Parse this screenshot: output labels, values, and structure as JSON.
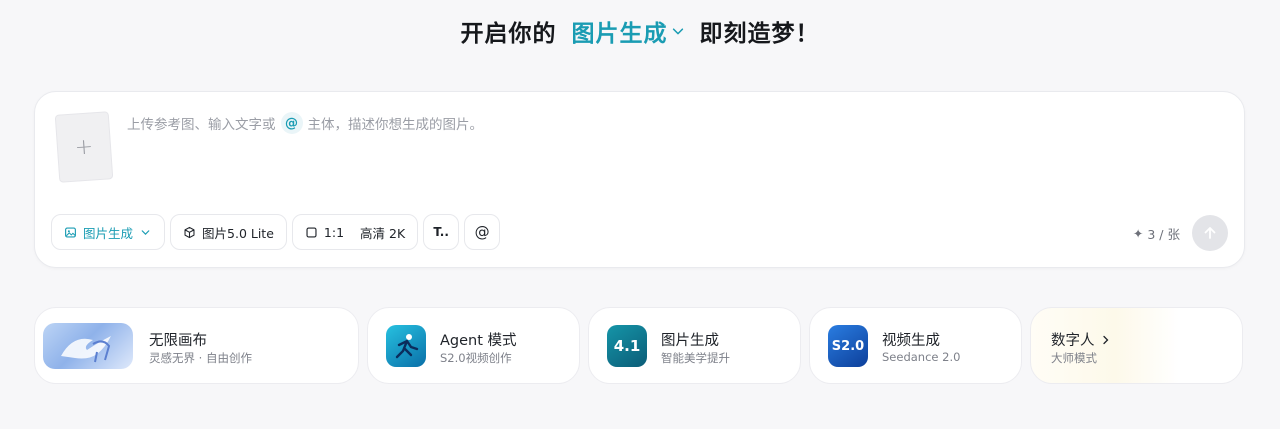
{
  "headline": {
    "prefix": "开启你的",
    "mode": "图片生成",
    "suffix": "即刻造梦！"
  },
  "composer": {
    "upload_symbol": "+",
    "prompt_part1": "上传参考图、输入文字或",
    "at_symbol": "@",
    "prompt_part2": "主体，描述你想生成的图片。"
  },
  "toolbar": {
    "mode_label": "图片生成",
    "model_label": "图片5.0 Lite",
    "ratio_label": "1:1",
    "quality_label": "高清 2K",
    "text_tool_symbol": "T..",
    "mention_symbol": "@"
  },
  "cost": {
    "symbol": "✦",
    "label": "3 / 张"
  },
  "cards": {
    "canvas": {
      "title": "无限画布",
      "subtitle": "灵感无界 · 自由创作"
    },
    "agent": {
      "title": "Agent 模式",
      "subtitle": "S2.0视频创作"
    },
    "image": {
      "title": "图片生成",
      "subtitle": "智能美学提升",
      "badge": "4.1"
    },
    "video": {
      "title": "视频生成",
      "subtitle": "Seedance 2.0",
      "badge": "S2.0"
    },
    "avatar": {
      "title": "数字人",
      "subtitle": "大师模式"
    }
  },
  "colors": {
    "accent": "#1a9cb3",
    "background": "#f7f7f9",
    "send_disabled": "#e3e4e8"
  },
  "icons": [
    "chevron-down-icon",
    "image-icon",
    "cube-icon",
    "square-icon",
    "text-format-icon",
    "at-icon",
    "sparkle-icon",
    "arrow-up-icon",
    "chevron-right-icon"
  ]
}
